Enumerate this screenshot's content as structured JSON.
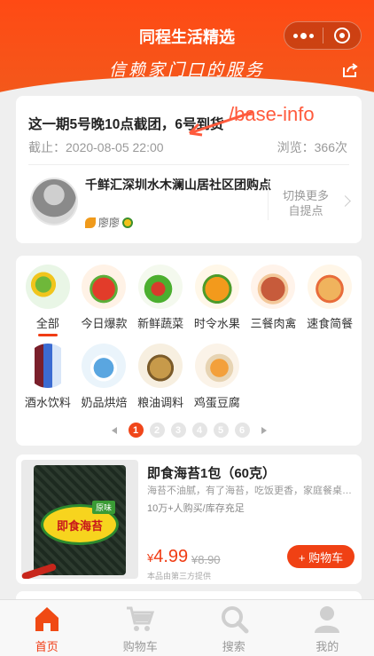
{
  "header": {
    "title": "同程生活精选",
    "slogan": "信赖家门口的服务",
    "colors": {
      "brand": "#f04a14"
    }
  },
  "info": {
    "cutoff_text": "这一期5号晚10点截团，6号到货",
    "deadline": "截止：2020-08-05 22:00",
    "views": "浏览：366次",
    "annotation": "/base-info",
    "group_name": "千鲜汇深圳水木澜山居社区团购点",
    "leader_name": "廖廖",
    "switch_text": "切换更多自提点"
  },
  "categories": [
    {
      "label": "全部",
      "icon": "qianxianhui-logo-icon",
      "active": true
    },
    {
      "label": "今日爆款",
      "icon": "hot-fruit-icon"
    },
    {
      "label": "新鲜蔬菜",
      "icon": "vegetables-icon"
    },
    {
      "label": "时令水果",
      "icon": "fruits-icon"
    },
    {
      "label": "三餐肉禽",
      "icon": "meat-icon"
    },
    {
      "label": "速食简餐",
      "icon": "noodles-icon"
    },
    {
      "label": "酒水饮料",
      "icon": "drinks-icon"
    },
    {
      "label": "奶品烘焙",
      "icon": "dairy-icon"
    },
    {
      "label": "粮油调料",
      "icon": "grain-oil-icon"
    },
    {
      "label": "鸡蛋豆腐",
      "icon": "eggs-icon"
    }
  ],
  "pager": {
    "pages": [
      "1",
      "2",
      "3",
      "4",
      "5",
      "6"
    ],
    "current": "1"
  },
  "product": {
    "title": "即食海苔1包（60克）",
    "desc": "海苔不油腻，有了海苔，吃饭更香，家庭餐桌必备",
    "sales": "10万+人购买/库存充足",
    "currency": "¥",
    "price": "4.99",
    "old_price": "¥8.90",
    "third_party": "本品由第三方提供",
    "cart_button": "+ 购物车",
    "package_text": "即食海苔",
    "package_tag": "原味"
  },
  "tabs": [
    {
      "label": "首页",
      "icon": "home-icon",
      "active": true
    },
    {
      "label": "购物车",
      "icon": "cart-icon"
    },
    {
      "label": "搜索",
      "icon": "search-icon"
    },
    {
      "label": "我的",
      "icon": "user-icon"
    }
  ]
}
